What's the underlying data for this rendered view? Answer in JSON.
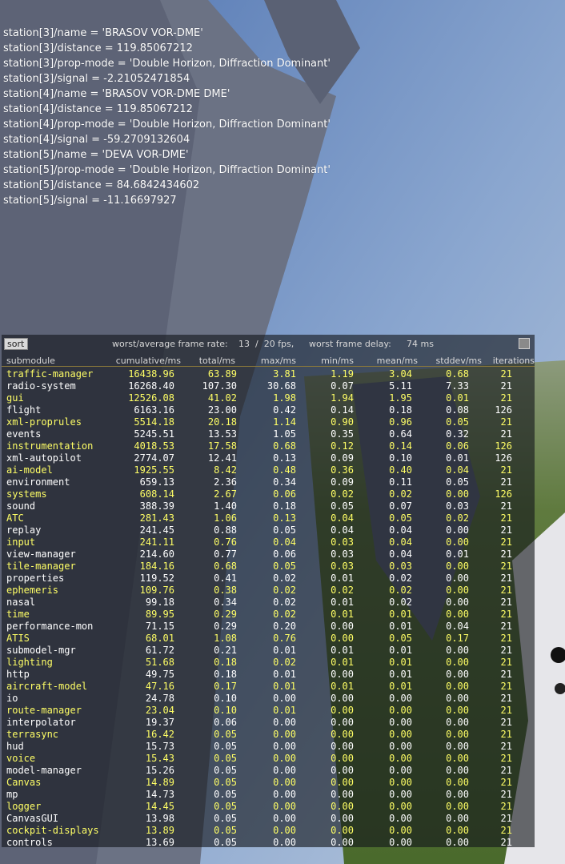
{
  "colors": {
    "highlight_text": "#ffff66",
    "normal_text": "#ffffff",
    "header_text": "#d8d8d8",
    "panel_bg": "rgba(20,22,28,0.62)"
  },
  "property_lines": [
    "station[3]/name = 'BRASOV VOR-DME'",
    "station[3]/distance = 119.85067212",
    "station[3]/prop-mode = 'Double Horizon, Diffraction Dominant'",
    "station[3]/signal = -2.21052471854",
    "station[4]/name = 'BRASOV VOR-DME DME'",
    "station[4]/distance = 119.85067212",
    "station[4]/prop-mode = 'Double Horizon, Diffraction Dominant'",
    "station[4]/signal = -59.2709132604",
    "station[5]/name = 'DEVA VOR-DME'",
    "station[5]/prop-mode = 'Double Horizon, Diffraction Dominant'",
    "station[5]/distance = 84.6842434602",
    "station[5]/signal = -11.16697927"
  ],
  "perf": {
    "sort_label": "sort",
    "frame_rate_label": "worst/average frame rate:",
    "frame_rate_value": "13  /  20 fps,",
    "frame_delay_label": "worst frame delay:",
    "frame_delay_value": "74 ms",
    "columns": [
      "submodule",
      "cumulative/ms",
      "total/ms",
      "max/ms",
      "min/ms",
      "mean/ms",
      "stddev/ms",
      "iterations"
    ],
    "rows": [
      [
        "traffic-manager",
        "16438.96",
        "63.89",
        "3.81",
        "1.19",
        "3.04",
        "0.68",
        "21"
      ],
      [
        "radio-system",
        "16268.40",
        "107.30",
        "30.68",
        "0.07",
        "5.11",
        "7.33",
        "21"
      ],
      [
        "gui",
        "12526.08",
        "41.02",
        "1.98",
        "1.94",
        "1.95",
        "0.01",
        "21"
      ],
      [
        "flight",
        "6163.16",
        "23.00",
        "0.42",
        "0.14",
        "0.18",
        "0.08",
        "126"
      ],
      [
        "xml-proprules",
        "5514.18",
        "20.18",
        "1.14",
        "0.90",
        "0.96",
        "0.05",
        "21"
      ],
      [
        "events",
        "5245.51",
        "13.53",
        "1.05",
        "0.35",
        "0.64",
        "0.32",
        "21"
      ],
      [
        "instrumentation",
        "4018.53",
        "17.58",
        "0.68",
        "0.12",
        "0.14",
        "0.06",
        "126"
      ],
      [
        "xml-autopilot",
        "2774.07",
        "12.41",
        "0.13",
        "0.09",
        "0.10",
        "0.01",
        "126"
      ],
      [
        "ai-model",
        "1925.55",
        "8.42",
        "0.48",
        "0.36",
        "0.40",
        "0.04",
        "21"
      ],
      [
        "environment",
        "659.13",
        "2.36",
        "0.34",
        "0.09",
        "0.11",
        "0.05",
        "21"
      ],
      [
        "systems",
        "608.14",
        "2.67",
        "0.06",
        "0.02",
        "0.02",
        "0.00",
        "126"
      ],
      [
        "sound",
        "388.39",
        "1.40",
        "0.18",
        "0.05",
        "0.07",
        "0.03",
        "21"
      ],
      [
        "ATC",
        "281.43",
        "1.06",
        "0.13",
        "0.04",
        "0.05",
        "0.02",
        "21"
      ],
      [
        "replay",
        "241.45",
        "0.88",
        "0.05",
        "0.04",
        "0.04",
        "0.00",
        "21"
      ],
      [
        "input",
        "241.11",
        "0.76",
        "0.04",
        "0.03",
        "0.04",
        "0.00",
        "21"
      ],
      [
        "view-manager",
        "214.60",
        "0.77",
        "0.06",
        "0.03",
        "0.04",
        "0.01",
        "21"
      ],
      [
        "tile-manager",
        "184.16",
        "0.68",
        "0.05",
        "0.03",
        "0.03",
        "0.00",
        "21"
      ],
      [
        "properties",
        "119.52",
        "0.41",
        "0.02",
        "0.01",
        "0.02",
        "0.00",
        "21"
      ],
      [
        "ephemeris",
        "109.76",
        "0.38",
        "0.02",
        "0.02",
        "0.02",
        "0.00",
        "21"
      ],
      [
        "nasal",
        "99.18",
        "0.34",
        "0.02",
        "0.01",
        "0.02",
        "0.00",
        "21"
      ],
      [
        "time",
        "89.95",
        "0.29",
        "0.02",
        "0.01",
        "0.01",
        "0.00",
        "21"
      ],
      [
        "performance-mon",
        "71.15",
        "0.29",
        "0.20",
        "0.00",
        "0.01",
        "0.04",
        "21"
      ],
      [
        "ATIS",
        "68.01",
        "1.08",
        "0.76",
        "0.00",
        "0.05",
        "0.17",
        "21"
      ],
      [
        "submodel-mgr",
        "61.72",
        "0.21",
        "0.01",
        "0.01",
        "0.01",
        "0.00",
        "21"
      ],
      [
        "lighting",
        "51.68",
        "0.18",
        "0.02",
        "0.01",
        "0.01",
        "0.00",
        "21"
      ],
      [
        "http",
        "49.75",
        "0.18",
        "0.01",
        "0.00",
        "0.01",
        "0.00",
        "21"
      ],
      [
        "aircraft-model",
        "47.16",
        "0.17",
        "0.01",
        "0.01",
        "0.01",
        "0.00",
        "21"
      ],
      [
        "io",
        "24.78",
        "0.10",
        "0.00",
        "0.00",
        "0.00",
        "0.00",
        "21"
      ],
      [
        "route-manager",
        "23.04",
        "0.10",
        "0.01",
        "0.00",
        "0.00",
        "0.00",
        "21"
      ],
      [
        "interpolator",
        "19.37",
        "0.06",
        "0.00",
        "0.00",
        "0.00",
        "0.00",
        "21"
      ],
      [
        "terrasync",
        "16.42",
        "0.05",
        "0.00",
        "0.00",
        "0.00",
        "0.00",
        "21"
      ],
      [
        "hud",
        "15.73",
        "0.05",
        "0.00",
        "0.00",
        "0.00",
        "0.00",
        "21"
      ],
      [
        "voice",
        "15.43",
        "0.05",
        "0.00",
        "0.00",
        "0.00",
        "0.00",
        "21"
      ],
      [
        "model-manager",
        "15.26",
        "0.05",
        "0.00",
        "0.00",
        "0.00",
        "0.00",
        "21"
      ],
      [
        "Canvas",
        "14.89",
        "0.05",
        "0.00",
        "0.00",
        "0.00",
        "0.00",
        "21"
      ],
      [
        "mp",
        "14.73",
        "0.05",
        "0.00",
        "0.00",
        "0.00",
        "0.00",
        "21"
      ],
      [
        "logger",
        "14.45",
        "0.05",
        "0.00",
        "0.00",
        "0.00",
        "0.00",
        "21"
      ],
      [
        "CanvasGUI",
        "13.98",
        "0.05",
        "0.00",
        "0.00",
        "0.00",
        "0.00",
        "21"
      ],
      [
        "cockpit-displays",
        "13.89",
        "0.05",
        "0.00",
        "0.00",
        "0.00",
        "0.00",
        "21"
      ],
      [
        "controls",
        "13.69",
        "0.05",
        "0.00",
        "0.00",
        "0.00",
        "0.00",
        "21"
      ]
    ]
  }
}
